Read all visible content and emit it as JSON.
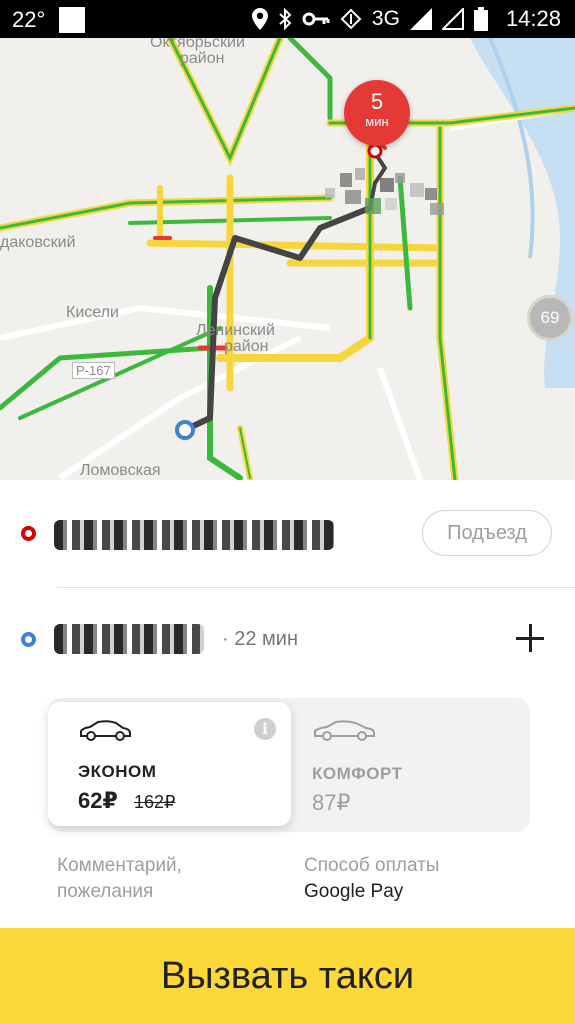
{
  "status_bar": {
    "temperature": "22°",
    "network": "3G",
    "time": "14:28",
    "icons": [
      "notification-square-icon",
      "location-icon",
      "bluetooth-icon",
      "key-icon",
      "data-arrows-icon",
      "signal-icon",
      "signal-empty-icon",
      "battery-icon"
    ]
  },
  "map": {
    "labels": {
      "oktyabrsky": "Октябрьский",
      "rayon_top": "район",
      "vodakovsky": "дaковский",
      "kiseli": "Кисели",
      "leninsky": "Ленинский",
      "rayon_mid": "район",
      "road": "Р-167",
      "lomovskaya": "Ломовская"
    },
    "eta": {
      "value": "5",
      "unit": "мин"
    },
    "speed_limit": "69",
    "colors": {
      "traffic_green": "#3cb93c",
      "traffic_yellow": "#f5d63d",
      "traffic_red": "#e53935",
      "route": "#444444",
      "river": "#c6dff2"
    }
  },
  "route": {
    "from_entrance_button": "Подъезд",
    "duration": "· 22 мин"
  },
  "tariffs": [
    {
      "name": "ЭКОНОМ",
      "price": "62₽",
      "old_price": "162₽",
      "selected": true
    },
    {
      "name": "КОМФОРТ",
      "price": "87₽",
      "selected": false
    }
  ],
  "options": {
    "comment_label": "Комментарий, пожелания",
    "payment_label": "Способ оплаты",
    "payment_value": "Google Pay"
  },
  "call_button": "Вызвать такси",
  "colors": {
    "accent": "#fdd839",
    "point_a": "#d50000",
    "point_b": "#3f7fd6"
  }
}
